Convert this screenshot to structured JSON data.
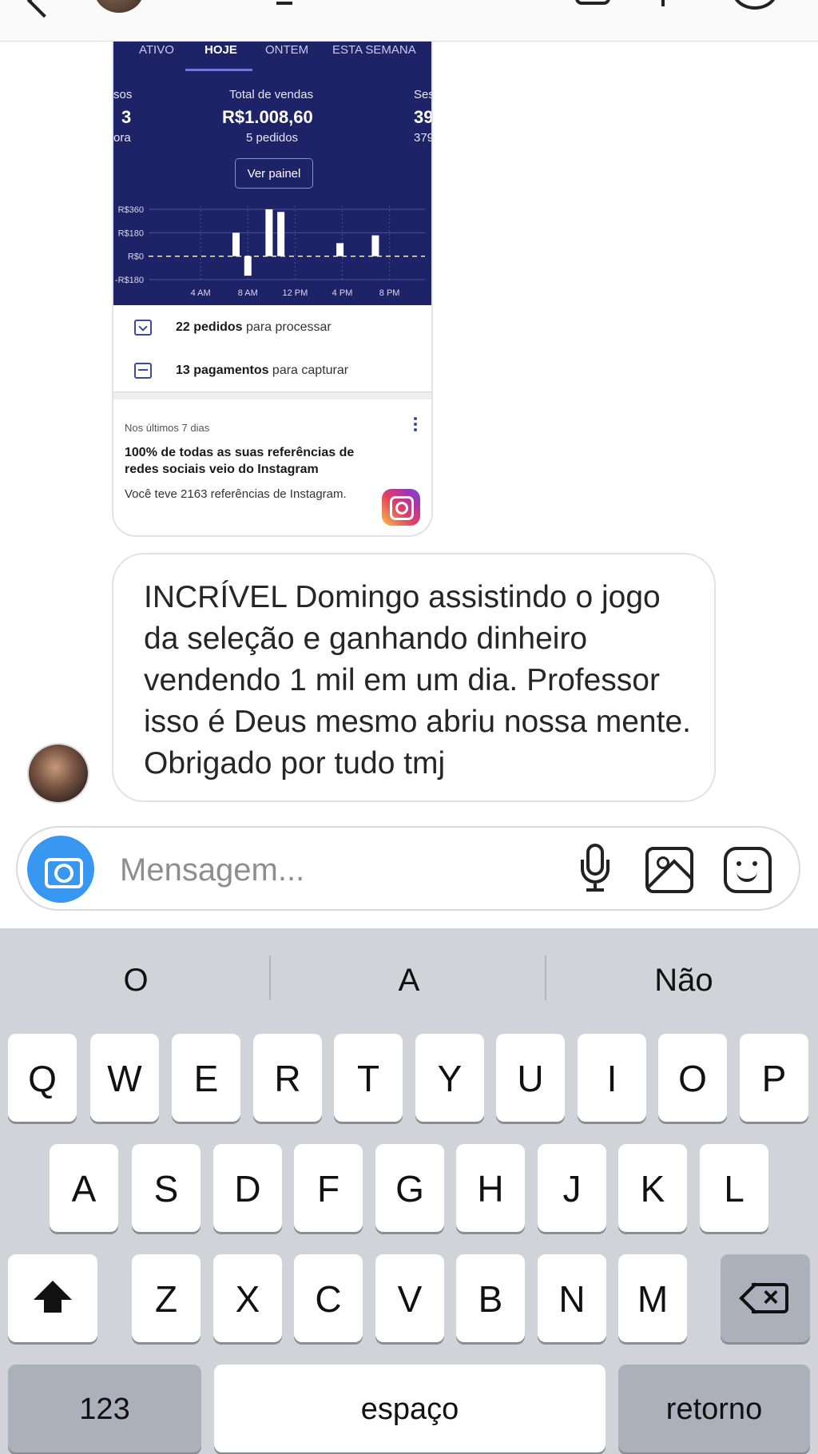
{
  "shared_card": {
    "tabs": [
      "ATIVO",
      "HOJE",
      "ONTEM",
      "ESTA SEMANA"
    ],
    "left_metric": {
      "label": "sos",
      "value": "3",
      "sub": "ora"
    },
    "center_metric": {
      "label": "Total de vendas",
      "value": "R$1.008,60",
      "sub": "5 pedidos"
    },
    "right_metric": {
      "label": "Ses",
      "value": "39",
      "sub": "379"
    },
    "button": "Ver painel",
    "rows": [
      {
        "bold": "22 pedidos",
        "rest": " para processar"
      },
      {
        "bold": "13 pagamentos",
        "rest": " para capturar"
      }
    ],
    "insight": {
      "kicker": "Nos últimos 7 dias",
      "headline": "100% de todas as suas referências de redes sociais veio do Instagram",
      "body": "Você teve 2163 referências de Instagram."
    }
  },
  "chart_data": {
    "type": "bar",
    "y_tick_labels": [
      "R$360",
      "R$180",
      "R$0",
      "-R$180"
    ],
    "x_tick_labels": [
      "4 AM",
      "8 AM",
      "12 PM",
      "4 PM",
      "8 PM"
    ],
    "ylim": [
      -180,
      360
    ],
    "bars": [
      {
        "x": 7.0,
        "y": 180
      },
      {
        "x": 8.0,
        "y": -150
      },
      {
        "x": 9.8,
        "y": 360
      },
      {
        "x": 10.8,
        "y": 340
      },
      {
        "x": 15.8,
        "y": 100
      },
      {
        "x": 18.8,
        "y": 160
      }
    ],
    "grid": true
  },
  "message": {
    "text": "INCRÍVEL Domingo assistindo o jogo da seleção e ganhando dinheiro vendendo 1 mil em um dia.  Professor isso é Deus mesmo abriu nossa mente.  Obrigado por tudo tmj"
  },
  "composer": {
    "placeholder": "Mensagem..."
  },
  "keyboard": {
    "suggestions": [
      "O",
      "A",
      "Não"
    ],
    "row1": [
      "Q",
      "W",
      "E",
      "R",
      "T",
      "Y",
      "U",
      "I",
      "O",
      "P"
    ],
    "row2": [
      "A",
      "S",
      "D",
      "F",
      "G",
      "H",
      "J",
      "K",
      "L"
    ],
    "row3": [
      "Z",
      "X",
      "C",
      "V",
      "B",
      "N",
      "M"
    ],
    "numbers_label": "123",
    "space_label": "espaço",
    "return_label": "retorno"
  }
}
